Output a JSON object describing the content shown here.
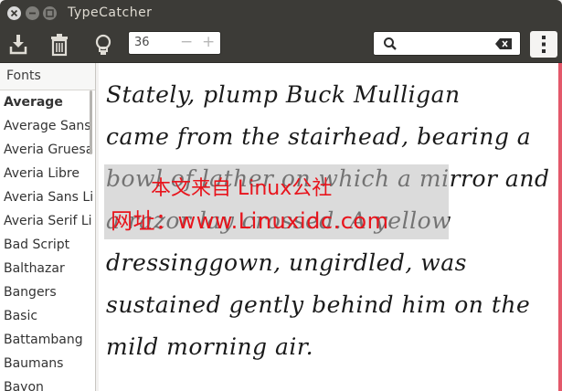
{
  "window": {
    "title": "TypeCatcher"
  },
  "toolbar": {
    "font_size_value": "36",
    "decrement_glyph": "−",
    "increment_glyph": "+",
    "search_placeholder": "",
    "icons": [
      "download-icon",
      "trash-icon",
      "lightbulb-icon",
      "search-icon",
      "clear-icon",
      "menu-icon"
    ]
  },
  "sidebar": {
    "header": "Fonts",
    "items": [
      "Average",
      "Average Sans",
      "Averia Gruesa",
      "Averia Libre",
      "Averia Sans Li",
      "Averia Serif Li",
      "Bad Script",
      "Balthazar",
      "Bangers",
      "Basic",
      "Battambang",
      "Baumans",
      "Bayon"
    ]
  },
  "preview": {
    "lines": [
      "Stately, plump Buck Mulligan",
      "came from the stairhead, bearing a",
      "bowl of lather on which a mirror and",
      "a razor lay crossed. A yellow",
      "dressinggown, ungirdled, was",
      "sustained gently behind him on the",
      "mild morning air."
    ]
  },
  "watermark": {
    "line1": "本文来自 Linux公社",
    "line2": "网址：www.Linuxidc.com"
  },
  "colors": {
    "titlebar": "#3c3b37",
    "accent_edge": "#e3586a",
    "watermark": "#e8141c"
  }
}
